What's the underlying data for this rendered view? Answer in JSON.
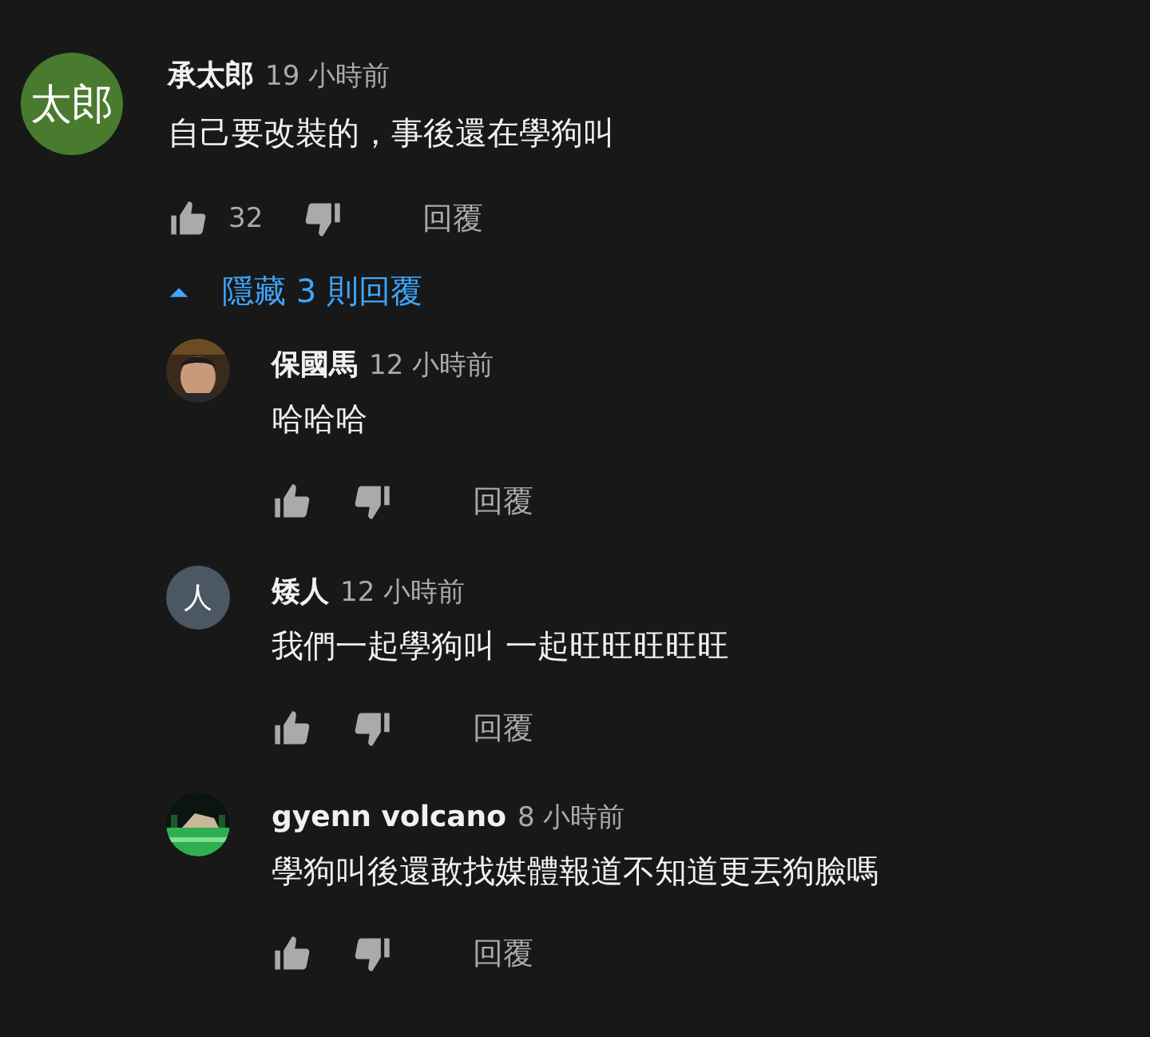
{
  "comment": {
    "avatar": {
      "kind": "text",
      "text": "太郎",
      "color": "#4a7a2e"
    },
    "author": "承太郎",
    "time": "19 小時前",
    "text": "自己要改裝的，事後還在學狗叫",
    "likes": "32",
    "reply_label": "回覆"
  },
  "replies_toggle": {
    "label": "隱藏 3 則回覆",
    "expanded": true
  },
  "replies": [
    {
      "author": "保國馬",
      "time": "12 小時前",
      "text": "哈哈哈",
      "reply_label": "回覆"
    },
    {
      "avatar": {
        "kind": "text",
        "text": "人",
        "color": "#4b5763"
      },
      "author": "矮人",
      "time": "12 小時前",
      "text": "我們一起學狗叫 一起旺旺旺旺旺",
      "reply_label": "回覆"
    },
    {
      "author": "gyenn volcano",
      "time": "8 小時前",
      "text": "學狗叫後還敢找媒體報道不知道更丟狗臉嗎",
      "reply_label": "回覆"
    }
  ]
}
